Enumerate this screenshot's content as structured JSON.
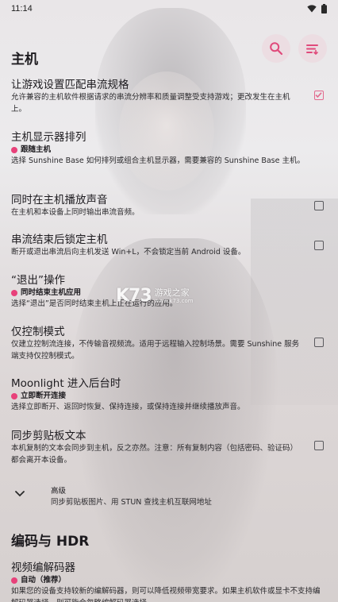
{
  "status_bar": {
    "time": "11:14",
    "icons": [
      "wifi-icon",
      "battery-icon"
    ]
  },
  "toolbar": {
    "search_icon": "search-icon",
    "sort_icon": "sort-list-icon"
  },
  "colors": {
    "accent": "#e8417a",
    "fab_bg": "#ecdce2",
    "fab_icon": "#e04a7b"
  },
  "sections": {
    "host": "主机",
    "encoding": "编码与 HDR"
  },
  "settings": {
    "match_stream_spec": {
      "title": "让游戏设置匹配串流规格",
      "desc": "允许兼容的主机软件根据请求的串流分辨率和质量调整受支持游戏；更改发生在主机上。",
      "checked": true
    },
    "display_arrangement": {
      "title": "主机显示器排列",
      "value": "跟随主机",
      "desc": "选择 Sunshine Base 如何排列或组合主机显示器，需要兼容的 Sunshine Base 主机。"
    },
    "play_audio_both": {
      "title": "同时在主机播放声音",
      "desc": "在主机和本设备上同时输出串流音频。",
      "checked": false
    },
    "lock_host": {
      "title": "串流结束后锁定主机",
      "desc": "断开或退出串流后向主机发送 Win+L，不会锁定当前 Android 设备。",
      "checked": false
    },
    "quit_action": {
      "title": "“退出”操作",
      "value": "同时结束主机应用",
      "desc": "选择“退出”是否同时结束主机上正在运行的应用。"
    },
    "control_only": {
      "title": "仅控制模式",
      "desc": "仅建立控制流连接，不传输音视频流。适用于远程输入控制场景。需要 Sunshine 服务端支持仅控制模式。",
      "checked": false
    },
    "background": {
      "title": "Moonlight 进入后台时",
      "value": "立即断开连接",
      "desc": "选择立即断开、返回时恢复、保持连接，或保持连接并继续播放声音。"
    },
    "clipboard_sync": {
      "title": "同步剪贴板文本",
      "desc": "本机复制的文本会同步到主机，反之亦然。注意：所有复制内容（包括密码、验证码）都会离开本设备。",
      "checked": false
    },
    "advanced": {
      "title": "高级",
      "desc": "同步剪贴板图片、用 STUN 查找主机互联网地址"
    },
    "video_decoder": {
      "title": "视频编解码器",
      "value": "自动（推荐）",
      "desc": "如果您的设备支持较新的编解码器，则可以降低视频带宽要求。如果主机软件或显卡不支持编解码器选择，则可能会忽略编解码器选择。"
    }
  },
  "watermark": {
    "logo": "K73",
    "cn": "游戏之家",
    "en": "www.k73.com"
  }
}
